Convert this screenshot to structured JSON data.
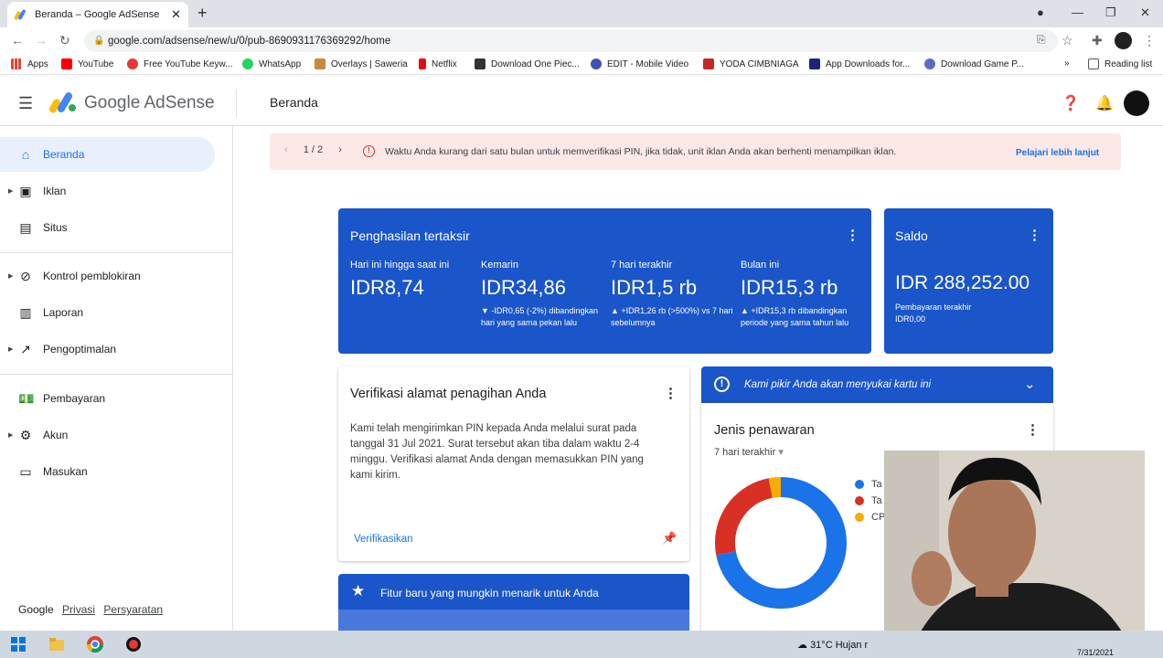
{
  "browser": {
    "tab_title": "Beranda – Google AdSense",
    "url": "google.com/adsense/new/u/0/pub-8690931176369292/home",
    "bookmarks": [
      "Apps",
      "YouTube",
      "Free YouTube Keyw...",
      "WhatsApp",
      "Overlays | Saweria",
      "Netflix",
      "Download One Piec...",
      "EDIT - Mobile Video",
      "YODA CIMBNIAGA",
      "App Downloads for...",
      "Download Game P..."
    ],
    "reading_list": "Reading list",
    "more_bookmarks": "»"
  },
  "app": {
    "brand": "Google AdSense",
    "page_title": "Beranda"
  },
  "sidebar": {
    "items": [
      {
        "label": "Beranda",
        "icon": "home-icon"
      },
      {
        "label": "Iklan",
        "icon": "ads-icon"
      },
      {
        "label": "Situs",
        "icon": "sites-icon"
      },
      {
        "label": "Kontrol pemblokiran",
        "icon": "block-icon"
      },
      {
        "label": "Laporan",
        "icon": "reports-icon"
      },
      {
        "label": "Pengoptimalan",
        "icon": "trending-icon"
      },
      {
        "label": "Pembayaran",
        "icon": "payments-icon"
      },
      {
        "label": "Akun",
        "icon": "gear-icon"
      },
      {
        "label": "Masukan",
        "icon": "feedback-icon"
      }
    ],
    "footer": {
      "google": "Google",
      "privacy": "Privasi",
      "terms": "Persyaratan"
    }
  },
  "alert": {
    "pager": "1 / 2",
    "message": "Waktu Anda kurang dari satu bulan untuk memverifikasi PIN, jika tidak, unit iklan Anda akan berhenti menampilkan iklan.",
    "link": "Pelajari lebih lanjut"
  },
  "earnings": {
    "title": "Penghasilan tertaksir",
    "metrics": [
      {
        "label": "Hari ini hingga saat ini",
        "value": "IDR8,74",
        "compare": ""
      },
      {
        "label": "Kemarin",
        "value": "IDR34,86",
        "compare": "▼ -IDR0,65 (-2%) dibandingkan hari yang sama pekan lalu"
      },
      {
        "label": "7 hari terakhir",
        "value": "IDR1,5 rb",
        "compare": "▲ +IDR1,26 rb (>500%) vs 7 hari sebelumnya"
      },
      {
        "label": "Bulan ini",
        "value": "IDR15,3 rb",
        "compare": "▲ +IDR15,3 rb dibandingkan periode yang sama tahun lalu"
      }
    ]
  },
  "balance": {
    "title": "Saldo",
    "value": "IDR 288,252.00",
    "last_payment_label": "Pembayaran terakhir",
    "last_payment_value": "IDR0,00"
  },
  "verify_card": {
    "title": "Verifikasi alamat penagihan Anda",
    "body": "Kami telah mengirimkan PIN kepada Anda melalui surat pada tanggal 31 Jul 2021. Surat tersebut akan tiba dalam waktu 2-4 minggu. Verifikasi alamat Anda dengan memasukkan PIN yang kami kirim.",
    "action": "Verifikasikan"
  },
  "suggestion": {
    "text": "Kami pikir Anda akan menyukai kartu ini"
  },
  "offer_card": {
    "title": "Jenis penawaran",
    "period": "7 hari terakhir",
    "legend": [
      {
        "label": "Ta",
        "color": "#1a73e8"
      },
      {
        "label": "Ta",
        "color": "#d93025"
      },
      {
        "label": "CP",
        "color": "#f9ab00"
      }
    ],
    "donut": [
      {
        "fraction": 0.72,
        "color": "#1a73e8"
      },
      {
        "fraction": 0.25,
        "color": "#d93025"
      },
      {
        "fraction": 0.03,
        "color": "#f9ab00"
      }
    ]
  },
  "feature_card": {
    "text": "Fitur baru yang mungkin menarik untuk Anda"
  },
  "taskbar": {
    "weather": "31°C  Hujan r",
    "date": "7/31/2021"
  }
}
